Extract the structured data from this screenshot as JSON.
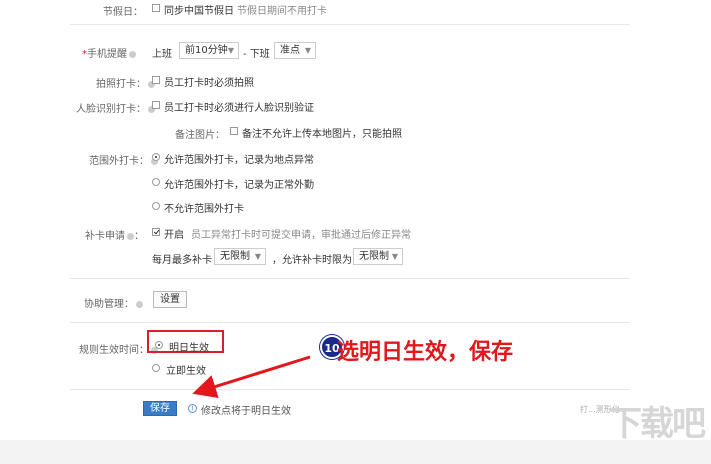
{
  "holiday": {
    "label": "节假日：",
    "sync_label": "同步中国节假日",
    "note": "节假日期间不用打卡"
  },
  "reminder": {
    "required_mark": "*",
    "label": "手机提醒",
    "work_on": "上班",
    "work_on_value": "前10分钟",
    "dash": "- 下班",
    "work_off_value": "准点"
  },
  "photo_clock": {
    "label": "拍照打卡：",
    "option": "员工打卡时必须拍照"
  },
  "face_clock": {
    "label": "人脸识别打卡：",
    "option": "员工打卡时必须进行人脸识别验证"
  },
  "remark_image": {
    "label": "备注图片：",
    "option": "备注不允许上传本地图片，只能拍照"
  },
  "out_of_range": {
    "label": "范围外打卡：",
    "options": [
      "允许范围外打卡，记录为地点异常",
      "允许范围外打卡，记录为正常外勤",
      "不允许范围外打卡"
    ],
    "selected_index": 0
  },
  "makeup": {
    "label": "补卡申请",
    "enable_label": "开启",
    "note": "员工异常打卡时可提交申请，审批通过后修正异常",
    "monthly_label": "每月最多补卡",
    "monthly_value": "无限制",
    "period_label": "，允许补卡时限为",
    "period_value": "无限制"
  },
  "assist": {
    "label": "协助管理：",
    "button": "设置"
  },
  "effective": {
    "label": "规则生效时间：",
    "options": [
      "明日生效",
      "立即生效"
    ],
    "selected_index": 0
  },
  "save": {
    "button": "保存",
    "info_icon": "i",
    "note": "修改点将于明日生效"
  },
  "annotation": {
    "step_number": "10",
    "text": "选明日生效，保存",
    "color": "#e1171c"
  },
  "watermark": {
    "text": "下载吧",
    "partial_link": "打...测形化"
  }
}
